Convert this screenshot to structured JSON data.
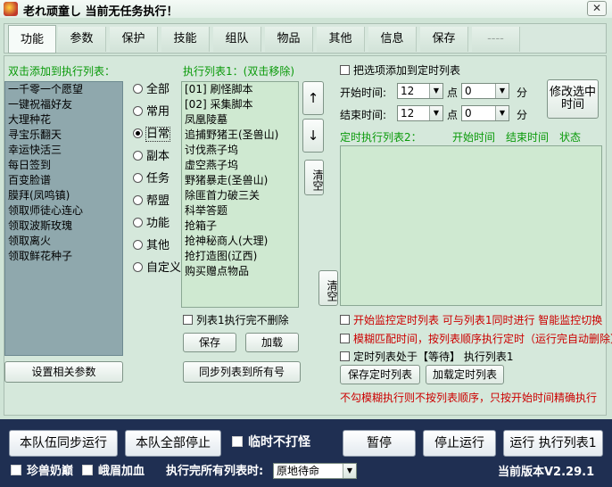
{
  "window": {
    "title": "老れ顽童し  当前无任务执行！",
    "close_glyph": "✕"
  },
  "tabs": [
    {
      "label": "功能"
    },
    {
      "label": "参数"
    },
    {
      "label": "保护"
    },
    {
      "label": "技能"
    },
    {
      "label": "组队"
    },
    {
      "label": "物品"
    },
    {
      "label": "其他"
    },
    {
      "label": "信息"
    },
    {
      "label": "保存"
    },
    {
      "label": "----"
    }
  ],
  "left": {
    "header": "双击添加到执行列表：",
    "items": [
      "一千零一个愿望",
      "一键祝福好友",
      "大理种花",
      "寻宝乐翻天",
      "幸运快活三",
      "每日签到",
      "百变脸谱",
      "膜拜(凤鸣镇)",
      "领取师徒心连心",
      "领取波斯玫瑰",
      "领取离火",
      "领取鲜花种子"
    ],
    "settings_button": "设置相关参数"
  },
  "categories": {
    "options": [
      "全部",
      "常用",
      "日常",
      "副本",
      "任务",
      "帮盟",
      "功能",
      "其他",
      "自定义"
    ],
    "selected": "日常"
  },
  "exec": {
    "header": "执行列表1：(双击移除)",
    "items": [
      "[01] 刷怪脚本",
      "[02] 采集脚本",
      "凤凰陵墓",
      "追捕野猪王(圣兽山)",
      "讨伐燕子坞",
      "虚空燕子坞",
      "野猪暴走(圣兽山)",
      "除匪首力破三关",
      "科举答题",
      "抢箱子",
      "抢神秘商人(大理)",
      "抢打造图(辽西)",
      "购买赠点物品"
    ],
    "up": "↑",
    "down": "↓",
    "clear": "清空",
    "keep_checkbox": "列表1执行完不删除",
    "save": "保存",
    "load": "加载",
    "sync": "同步列表到所有号"
  },
  "timer": {
    "add_option": "把选项添加到定时列表",
    "start_label": "开始时间:",
    "end_label": "结束时间:",
    "start_hour": "12",
    "start_min": "0",
    "end_hour": "12",
    "end_min": "0",
    "hour_unit": "点",
    "min_unit": "分",
    "modify_button": "修改选中时间",
    "list_header": "定时执行列表2：",
    "col_start": "开始时间",
    "col_end": "结束时间",
    "col_status": "状态",
    "clear": "清空",
    "opt_monitor": "开始监控定时列表  可与列表1同时进行  智能监控切换",
    "opt_fuzzy": "模糊匹配时间，按列表顺序执行定时（运行完自动删除）",
    "opt_wait": "定时列表处于【等待】 执行列表1",
    "save": "保存定时列表",
    "load": "加载定时列表",
    "note": "不勾模糊执行则不按列表顺序，只按开始时间精确执行"
  },
  "bottom": {
    "team_sync": "本队伍同步运行",
    "team_stop": "本队全部停止",
    "no_monster": "临时不打怪",
    "pause": "暂停",
    "stop": "停止运行",
    "run": "运行 执行列表1",
    "zhenman": "珍兽奶巅",
    "emei": "峨眉加血",
    "after_label": "执行完所有列表时:",
    "after_value": "原地待命",
    "version": "当前版本V2.29.1"
  },
  "colors": {
    "background": "#cfe4d6",
    "list_left": "#8fa8ad",
    "list_right": "#cfe9d1",
    "green_text": "#0a9a0a",
    "red_text": "#cc0000",
    "bottom_bar": "#1f2f52"
  }
}
